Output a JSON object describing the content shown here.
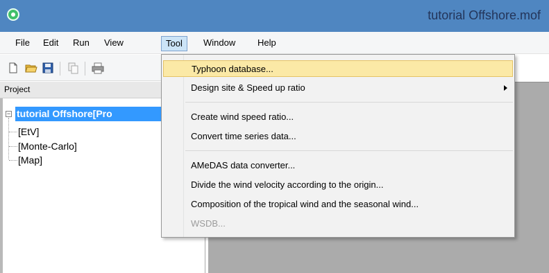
{
  "window": {
    "title": "tutorial Offshore.mof"
  },
  "menubar": {
    "items": [
      {
        "label": "File"
      },
      {
        "label": "Edit"
      },
      {
        "label": "Run"
      },
      {
        "label": "View"
      },
      {
        "label": "Tool"
      },
      {
        "label": "Window"
      },
      {
        "label": "Help"
      }
    ]
  },
  "toolbar": {
    "icons": [
      "new-file-icon",
      "open-folder-icon",
      "save-icon",
      "copy-icon",
      "print-icon"
    ]
  },
  "project": {
    "header": "Project",
    "root": "tutorial Offshore[Pro",
    "children": [
      "[EtV]",
      "[Monte-Carlo]",
      "[Map]"
    ]
  },
  "tool_menu": {
    "items": [
      {
        "label": "Typhoon database...",
        "highlighted": true
      },
      {
        "label": "Design site & Speed up ratio",
        "submenu": true
      },
      {
        "label": "Create wind speed ratio..."
      },
      {
        "label": "Convert time series data..."
      },
      {
        "label": "AMeDAS data converter..."
      },
      {
        "label": "Divide the wind velocity according to the origin..."
      },
      {
        "label": "Composition of the tropical wind and the seasonal wind..."
      },
      {
        "label": "WSDB...",
        "disabled": true
      }
    ]
  },
  "colors": {
    "titlebar": "#4f86c1",
    "selection": "#3399ff",
    "menu_highlight": "#fbe9a6"
  }
}
